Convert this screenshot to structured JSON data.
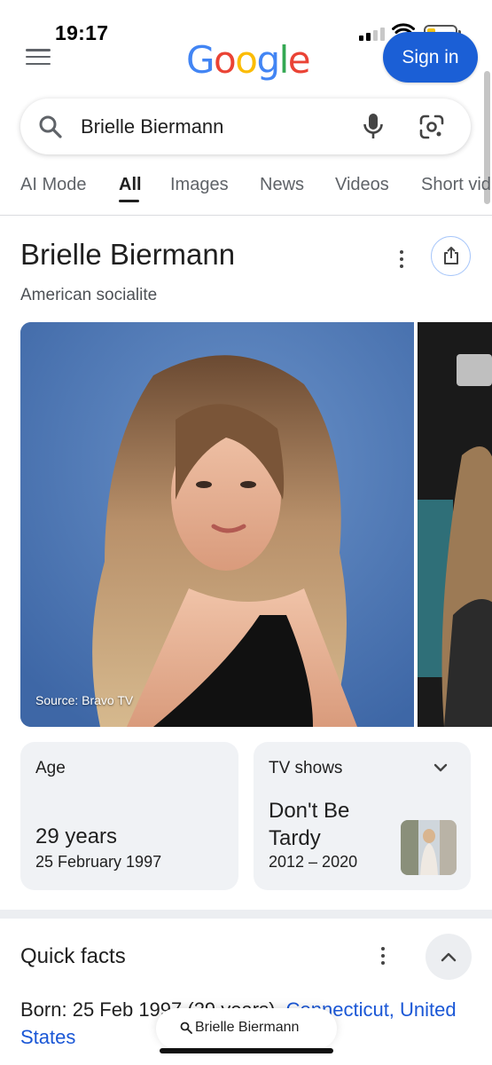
{
  "status_bar": {
    "time": "19:17"
  },
  "header": {
    "logo_letters": [
      {
        "ch": "G",
        "color": "#4285F4"
      },
      {
        "ch": "o",
        "color": "#EA4335"
      },
      {
        "ch": "o",
        "color": "#FBBC05"
      },
      {
        "ch": "g",
        "color": "#4285F4"
      },
      {
        "ch": "l",
        "color": "#34A853"
      },
      {
        "ch": "e",
        "color": "#EA4335"
      }
    ],
    "sign_in_label": "Sign in"
  },
  "search": {
    "query": "Brielle Biermann"
  },
  "tabs": [
    {
      "label": "AI Mode",
      "active": false
    },
    {
      "label": "All",
      "active": true
    },
    {
      "label": "Images",
      "active": false
    },
    {
      "label": "News",
      "active": false
    },
    {
      "label": "Videos",
      "active": false
    },
    {
      "label": "Short vid",
      "active": false
    }
  ],
  "knowledge_panel": {
    "title": "Brielle Biermann",
    "subtitle": "American socialite",
    "photo_source": "Source: Bravo TV",
    "age_card": {
      "label": "Age",
      "value": "29 years",
      "sub": "25 February 1997"
    },
    "tv_card": {
      "label": "TV shows",
      "title": "Don't Be Tardy",
      "years": "2012 – 2020"
    }
  },
  "quick_facts": {
    "title": "Quick facts",
    "born_label": "Born",
    "born_text": ": 25 Feb 1997 (29 years), ",
    "born_link": "Connecticut, United States"
  },
  "bottom_bar": {
    "query": "Brielle Biermann"
  },
  "colors": {
    "accent": "#1b5fd6",
    "link": "#1a57d6",
    "card_bg": "#f0f2f5"
  }
}
